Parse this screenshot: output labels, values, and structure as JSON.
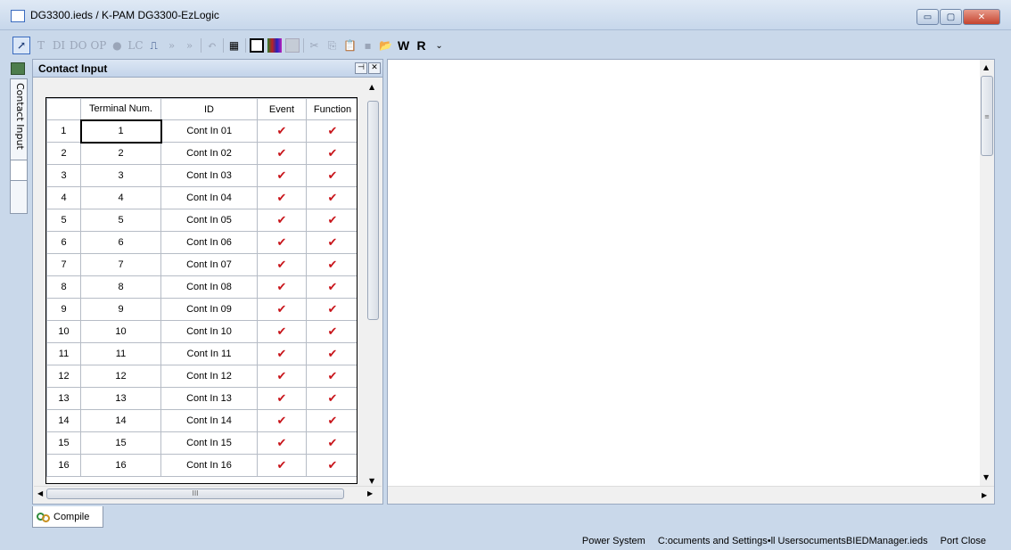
{
  "window": {
    "title": "DG3300.ieds / K-PAM DG3300-EzLogic",
    "buttons": {
      "minimize": "▭",
      "maximize": "▢",
      "close": "✕"
    }
  },
  "toolbar": {
    "items": [
      "T",
      "DI",
      "DO",
      "OP",
      "LC",
      "»",
      "»",
      "W",
      "R"
    ]
  },
  "sidebar": {
    "tab_label": "Contact Input"
  },
  "panel": {
    "title": "Contact Input",
    "pin_label": "⊣",
    "close_label": "✕",
    "columns": [
      "",
      "Terminal Num.",
      "ID",
      "Event",
      "Function"
    ],
    "rows": [
      {
        "row": "1",
        "terminal": "1",
        "id": "Cont In 01",
        "event": "✔",
        "function": "✔"
      },
      {
        "row": "2",
        "terminal": "2",
        "id": "Cont In 02",
        "event": "✔",
        "function": "✔"
      },
      {
        "row": "3",
        "terminal": "3",
        "id": "Cont In 03",
        "event": "✔",
        "function": "✔"
      },
      {
        "row": "4",
        "terminal": "4",
        "id": "Cont In 04",
        "event": "✔",
        "function": "✔"
      },
      {
        "row": "5",
        "terminal": "5",
        "id": "Cont In 05",
        "event": "✔",
        "function": "✔"
      },
      {
        "row": "6",
        "terminal": "6",
        "id": "Cont In 06",
        "event": "✔",
        "function": "✔"
      },
      {
        "row": "7",
        "terminal": "7",
        "id": "Cont In 07",
        "event": "✔",
        "function": "✔"
      },
      {
        "row": "8",
        "terminal": "8",
        "id": "Cont In 08",
        "event": "✔",
        "function": "✔"
      },
      {
        "row": "9",
        "terminal": "9",
        "id": "Cont In 09",
        "event": "✔",
        "function": "✔"
      },
      {
        "row": "10",
        "terminal": "10",
        "id": "Cont In 10",
        "event": "✔",
        "function": "✔"
      },
      {
        "row": "11",
        "terminal": "11",
        "id": "Cont In 11",
        "event": "✔",
        "function": "✔"
      },
      {
        "row": "12",
        "terminal": "12",
        "id": "Cont In 12",
        "event": "✔",
        "function": "✔"
      },
      {
        "row": "13",
        "terminal": "13",
        "id": "Cont In 13",
        "event": "✔",
        "function": "✔"
      },
      {
        "row": "14",
        "terminal": "14",
        "id": "Cont In 14",
        "event": "✔",
        "function": "✔"
      },
      {
        "row": "15",
        "terminal": "15",
        "id": "Cont In 15",
        "event": "✔",
        "function": "✔"
      },
      {
        "row": "16",
        "terminal": "16",
        "id": "Cont In 16",
        "event": "✔",
        "function": "✔"
      }
    ],
    "hscroll_grip": "III"
  },
  "bottom_tabs": [
    {
      "label": "Compile"
    }
  ],
  "status": {
    "system": "Power System",
    "path": "C:ocuments and Settings•ll UsersocumentsBIEDManager.ieds",
    "port": "Port Close"
  },
  "colors": {
    "check": "#c8141a",
    "accent": "#3a6bbf",
    "frame": "#c9d8ea"
  }
}
